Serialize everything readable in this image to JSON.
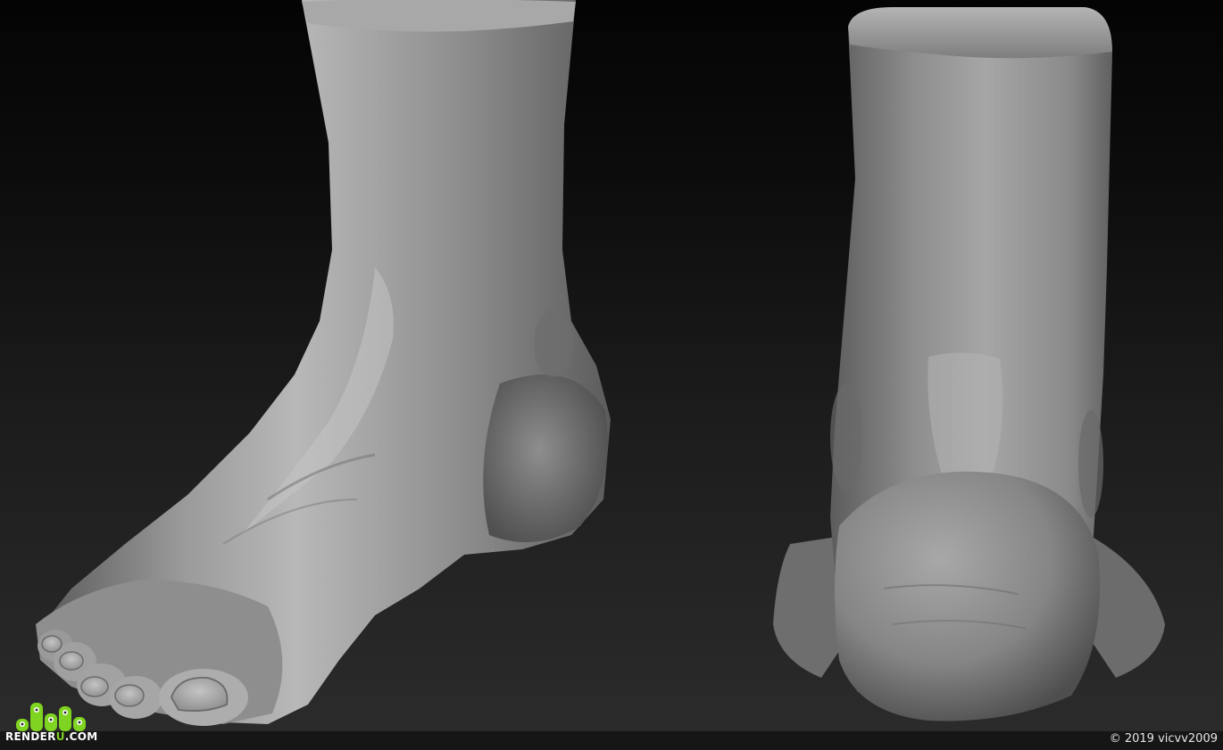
{
  "logo": {
    "prefix": "RENDER",
    "accent": "U",
    "suffix": ".COM",
    "accent_color": "#7fd321"
  },
  "copyright": "© 2019 vicvv2009",
  "colors": {
    "background_top": "#040404",
    "background_bottom": "#2c2c2c",
    "sculpt_light": "#c8c8c8",
    "sculpt_mid": "#8a8a8a",
    "sculpt_dark": "#4a4a4a"
  }
}
